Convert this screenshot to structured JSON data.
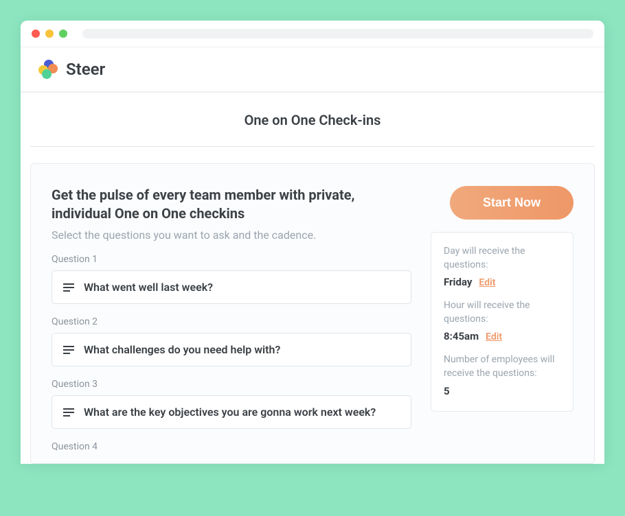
{
  "brand": "Steer",
  "page_title": "One on One Check-ins",
  "main": {
    "heading": "Get the pulse of every team member with private, individual One on One checkins",
    "subheading": "Select the questions you want to ask and the cadence.",
    "questions": [
      {
        "label": "Question 1",
        "text": "What went well last week?"
      },
      {
        "label": "Question 2",
        "text": "What challenges do you need help with?"
      },
      {
        "label": "Question 3",
        "text": "What are the key objectives you are gonna work next week?"
      },
      {
        "label": "Question 4",
        "text": ""
      }
    ],
    "cta_label": "Start Now"
  },
  "sidebar": {
    "day_label": "Day will receive the questions:",
    "day_value": "Friday",
    "hour_label": "Hour will receive the questions:",
    "hour_value": "8:45am",
    "employees_label": "Number of employees will receive the questions:",
    "employees_value": "5",
    "edit_label": "Edit"
  }
}
